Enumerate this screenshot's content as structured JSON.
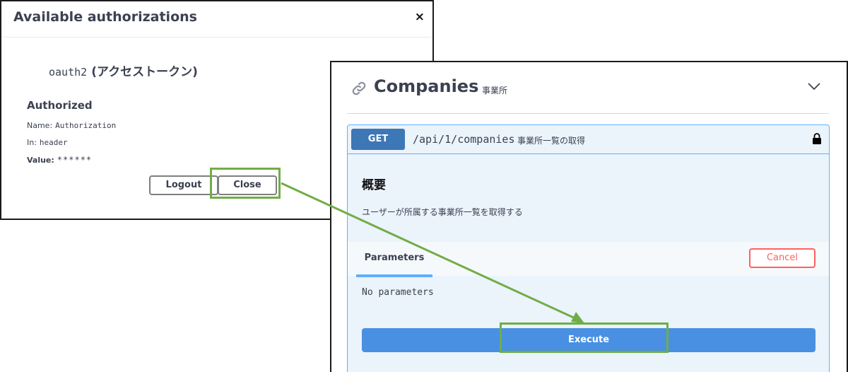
{
  "auth_dialog": {
    "title": "Available authorizations",
    "close_glyph": "×",
    "scheme_name": "oauth2",
    "scheme_description": "(アクセストークン)",
    "authorized_label": "Authorized",
    "name_label": "Name:",
    "name_value": "Authorization",
    "in_label": "In:",
    "in_value": "header",
    "value_label": "Value:",
    "value_value": "******",
    "logout_label": "Logout",
    "close_label": "Close"
  },
  "operation_panel": {
    "tag_title": "Companies",
    "tag_description": "事業所",
    "method": "GET",
    "path": "/api/1/companies",
    "summary": "事業所一覧の取得",
    "section_title": "概要",
    "description": "ユーザーが所属する事業所一覧を取得する",
    "parameters_tab": "Parameters",
    "cancel_label": "Cancel",
    "no_parameters": "No parameters",
    "execute_label": "Execute"
  },
  "colors": {
    "highlight": "#70ad47",
    "get_method": "#3d77b6",
    "get_border": "#61affe",
    "execute": "#4990e2",
    "cancel": "#ff6060"
  },
  "icons": {
    "link": "link-icon",
    "chevron": "chevron-down-icon",
    "lock": "lock-icon",
    "close": "close-icon"
  }
}
